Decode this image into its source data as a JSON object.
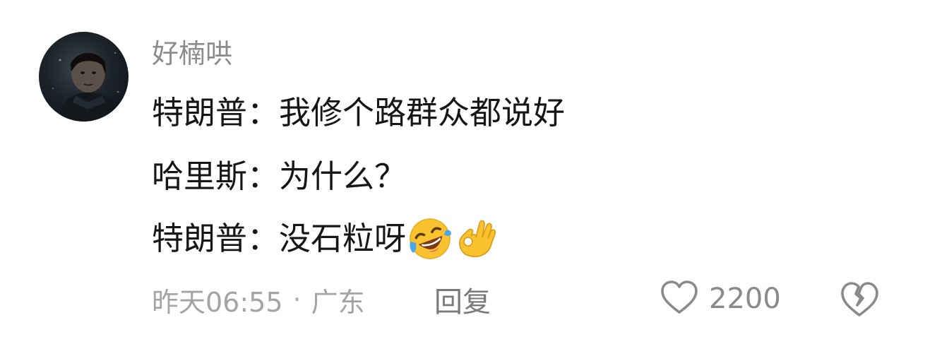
{
  "comment": {
    "username": "好楠哄",
    "lines": [
      "特朗普：我修个路群众都说好",
      "哈里斯：为什么？",
      "特朗普：没石粒呀"
    ],
    "emojis": [
      "rofl-emoji",
      "ok-hand-emoji"
    ],
    "time": "昨天06:55",
    "separator": "·",
    "location": "广东",
    "reply_label": "回复",
    "like_count": "2200"
  },
  "colors": {
    "username": "#8c8c8c",
    "text": "#161616",
    "meta": "#a4a4a4",
    "icon": "#8a8a8a",
    "emoji_yellow": "#f9c22e"
  }
}
